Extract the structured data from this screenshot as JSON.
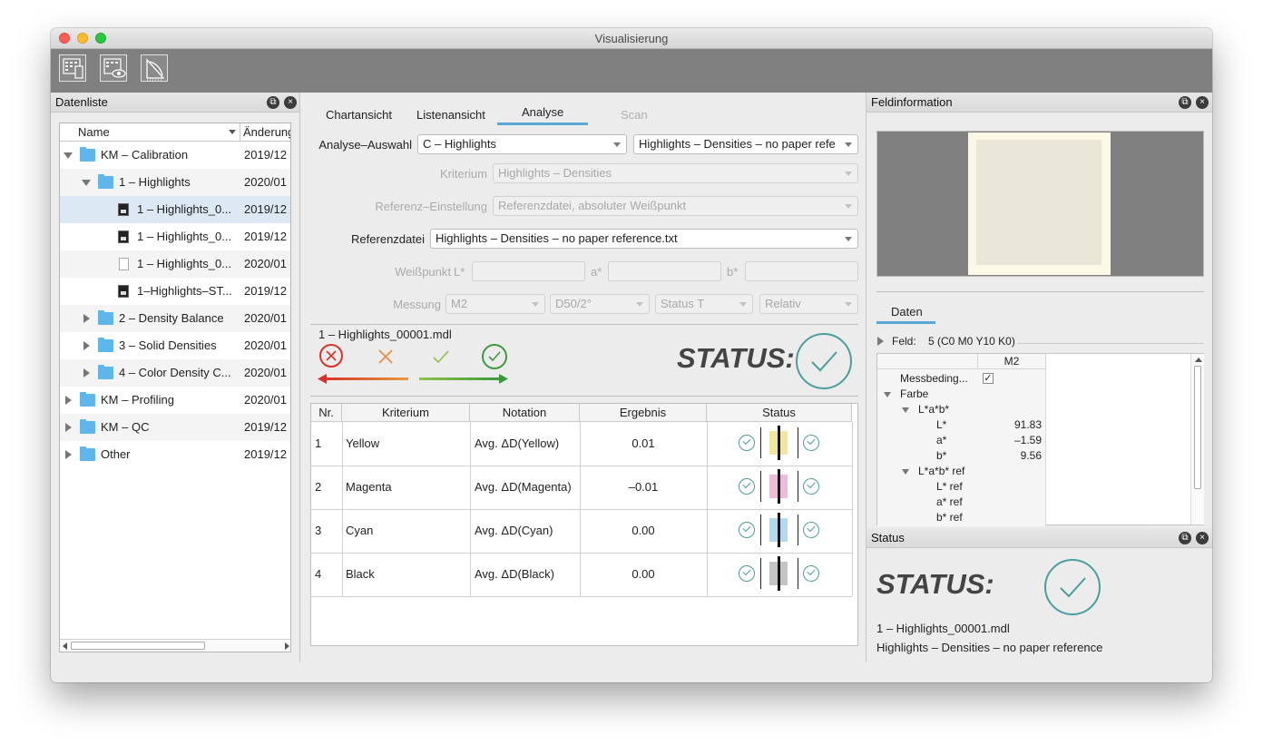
{
  "window": {
    "title": "Visualisierung"
  },
  "toolbar": {
    "icons": [
      "chart-device-icon",
      "chart-view-icon",
      "measure-icon"
    ]
  },
  "left_panel": {
    "title": "Datenliste",
    "columns": [
      "Name",
      "Änderung"
    ],
    "rows": [
      {
        "label": "KM – Calibration",
        "date": "2019/12"
      },
      {
        "label": "1 – Highlights",
        "date": "2020/01"
      },
      {
        "label": "1 – Highlights_0...",
        "date": "2019/12"
      },
      {
        "label": "1 – Highlights_0...",
        "date": "2019/12"
      },
      {
        "label": "1 – Highlights_0...",
        "date": "2020/01"
      },
      {
        "label": "1–Highlights–ST...",
        "date": "2019/12"
      },
      {
        "label": "2 – Density Balance",
        "date": "2020/01"
      },
      {
        "label": "3 – Solid Densities",
        "date": "2020/01"
      },
      {
        "label": "4 – Color Density C...",
        "date": "2020/01"
      },
      {
        "label": "KM – Profiling",
        "date": "2020/01"
      },
      {
        "label": "KM – QC",
        "date": "2019/12"
      },
      {
        "label": "Other",
        "date": "2019/12"
      }
    ]
  },
  "tabs": [
    {
      "label": "Chartansicht"
    },
    {
      "label": "Listenansicht"
    },
    {
      "label": "Analyse"
    },
    {
      "label": "Scan"
    }
  ],
  "analysis": {
    "auswahl_label": "Analyse–Auswahl",
    "auswahl_value": "C – Highlights",
    "auswahl_value2": "Highlights – Densities – no paper refe",
    "kriterium_label": "Kriterium",
    "kriterium_value": "Highlights – Densities",
    "referenz_einst_label": "Referenz–Einstellung",
    "referenz_einst_value": "Referenzdatei, absoluter Weißpunkt",
    "referenzdatei_label": "Referenzdatei",
    "referenzdatei_value": "Highlights – Densities – no paper reference.txt",
    "weisspunkt_label": "Weißpunkt",
    "l_label": "L*",
    "a_label": "a*",
    "b_label": "b*",
    "messung_label": "Messung",
    "messung_values": [
      "M2",
      "D50/2°",
      "Status T",
      "Relativ"
    ]
  },
  "status_area": {
    "filename": "1 – Highlights_00001.mdl",
    "status_text": "STATUS:"
  },
  "result_table": {
    "headers": [
      "Nr.",
      "Kriterium",
      "Notation",
      "Ergebnis",
      "Status"
    ],
    "rows": [
      {
        "nr": "1",
        "kriterium": "Yellow",
        "notation": "Avg. ΔD(Yellow)",
        "ergebnis": "0.01",
        "swatch": "#f2e6a0"
      },
      {
        "nr": "2",
        "kriterium": "Magenta",
        "notation": "Avg. ΔD(Magenta)",
        "ergebnis": "–0.01",
        "swatch": "#ecbcd8"
      },
      {
        "nr": "3",
        "kriterium": "Cyan",
        "notation": "Avg. ΔD(Cyan)",
        "ergebnis": "0.00",
        "swatch": "#b4d8ee"
      },
      {
        "nr": "4",
        "kriterium": "Black",
        "notation": "Avg. ΔD(Black)",
        "ergebnis": "0.00",
        "swatch": "#c4c4c4"
      }
    ]
  },
  "right_panel": {
    "title": "Feldinformation",
    "daten_tab": "Daten",
    "feld_label": "Feld:",
    "feld_value": "5 (C0 M0 Y10 K0)",
    "col_header": "M2",
    "props": [
      {
        "name": "Messbeding...",
        "value": ""
      },
      {
        "name": "Farbe",
        "value": ""
      },
      {
        "name": "L*a*b*",
        "value": ""
      },
      {
        "name": "L*",
        "value": "91.83"
      },
      {
        "name": "a*",
        "value": "–1.59"
      },
      {
        "name": "b*",
        "value": "9.56"
      },
      {
        "name": "L*a*b* ref",
        "value": ""
      },
      {
        "name": "L* ref",
        "value": ""
      },
      {
        "name": "a* ref",
        "value": ""
      },
      {
        "name": "b* ref",
        "value": ""
      }
    ]
  },
  "status_panel": {
    "title": "Status",
    "status_text": "STATUS:",
    "line1": "1 – Highlights_00001.mdl",
    "line2": "Highlights – Densities – no paper reference"
  },
  "colors": {
    "accent_tab": "#5aa8d8",
    "ok_teal": "#4a9e9b",
    "fail_red": "#d9322b",
    "warn_orange": "#e88a3a",
    "pass_green": "#6ab04c",
    "selected_row": "#dce9f4"
  }
}
